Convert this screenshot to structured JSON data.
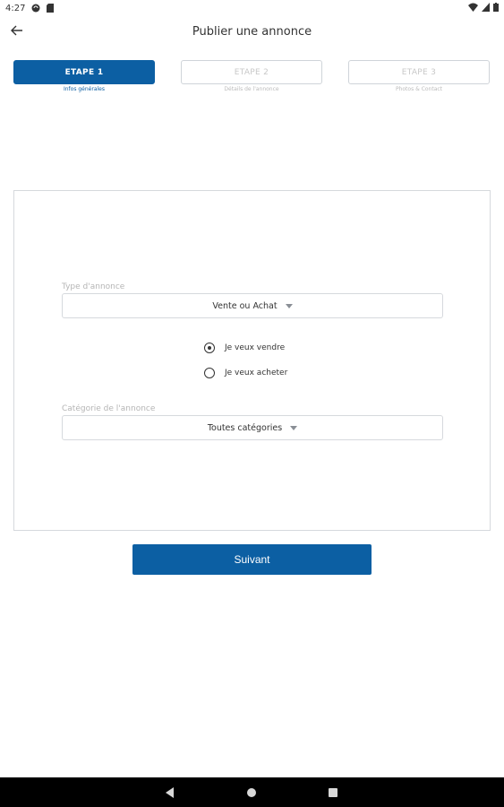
{
  "status_bar": {
    "time": "4:27",
    "left_icons": [
      "sync-icon",
      "sd-card-icon"
    ],
    "right_icons": [
      "wifi-icon",
      "cell-signal-icon",
      "battery-icon"
    ]
  },
  "app_bar": {
    "back_icon": "arrow-back-icon",
    "title": "Publier une annonce"
  },
  "stepper": {
    "steps": [
      {
        "label": "ETAPE 1",
        "subtitle": "Infos générales",
        "active": true
      },
      {
        "label": "ETAPE 2",
        "subtitle": "Détails de l'annonce",
        "active": false
      },
      {
        "label": "ETAPE 3",
        "subtitle": "Photos & Contact",
        "active": false
      }
    ]
  },
  "form": {
    "type_label": "Type d'annonce",
    "type_value": "Vente ou Achat",
    "radio_options": [
      {
        "label": "Je veux vendre",
        "checked": true
      },
      {
        "label": "Je veux acheter",
        "checked": false
      }
    ],
    "category_label": "Catégorie de l'annonce",
    "category_value": "Toutes catégories"
  },
  "next_button": "Suivant",
  "colors": {
    "primary": "#0c5fa3",
    "border": "#d6d9dd",
    "navbar": "#000000"
  },
  "nav_bar": {
    "icons": [
      "nav-back-icon",
      "nav-home-icon",
      "nav-recents-icon"
    ]
  }
}
